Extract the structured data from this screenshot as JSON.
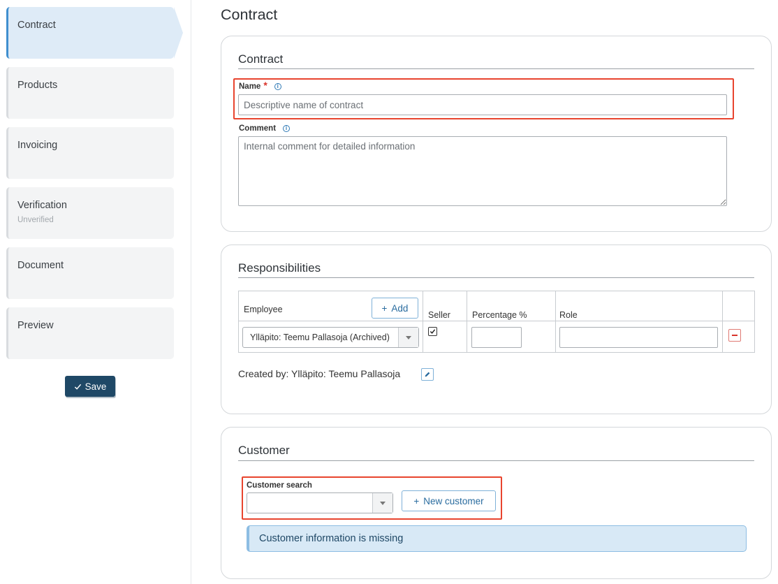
{
  "sidebar": {
    "steps": [
      {
        "label": "Contract",
        "sub": ""
      },
      {
        "label": "Products",
        "sub": ""
      },
      {
        "label": "Invoicing",
        "sub": ""
      },
      {
        "label": "Verification",
        "sub": "Unverified"
      },
      {
        "label": "Document",
        "sub": ""
      },
      {
        "label": "Preview",
        "sub": ""
      }
    ],
    "save_label": "Save"
  },
  "page_title": "Contract",
  "contract": {
    "title": "Contract",
    "name_label": "Name",
    "name_required_mark": "*",
    "name_placeholder": "Descriptive name of contract",
    "comment_label": "Comment",
    "comment_placeholder": "Internal comment for detailed information",
    "info_glyph": "i"
  },
  "responsibilities": {
    "title": "Responsibilities",
    "headers": {
      "employee": "Employee",
      "seller": "Seller",
      "percentage": "Percentage %",
      "role": "Role"
    },
    "add_label": "Add",
    "rows": [
      {
        "employee": "Ylläpito: Teemu Pallasoja (Archived)",
        "seller": true,
        "percentage": "",
        "role": ""
      }
    ],
    "created_by": "Created by: Ylläpito: Teemu Pallasoja"
  },
  "customer": {
    "title": "Customer",
    "search_label": "Customer search",
    "search_value": "",
    "new_customer_label": "New customer",
    "missing_message": "Customer information is missing"
  },
  "colors": {
    "primary": "#1f4866",
    "accent": "#3f8fcf",
    "highlight": "#e8442e",
    "danger": "#d9342b",
    "info_bg": "#d8e9f6"
  }
}
